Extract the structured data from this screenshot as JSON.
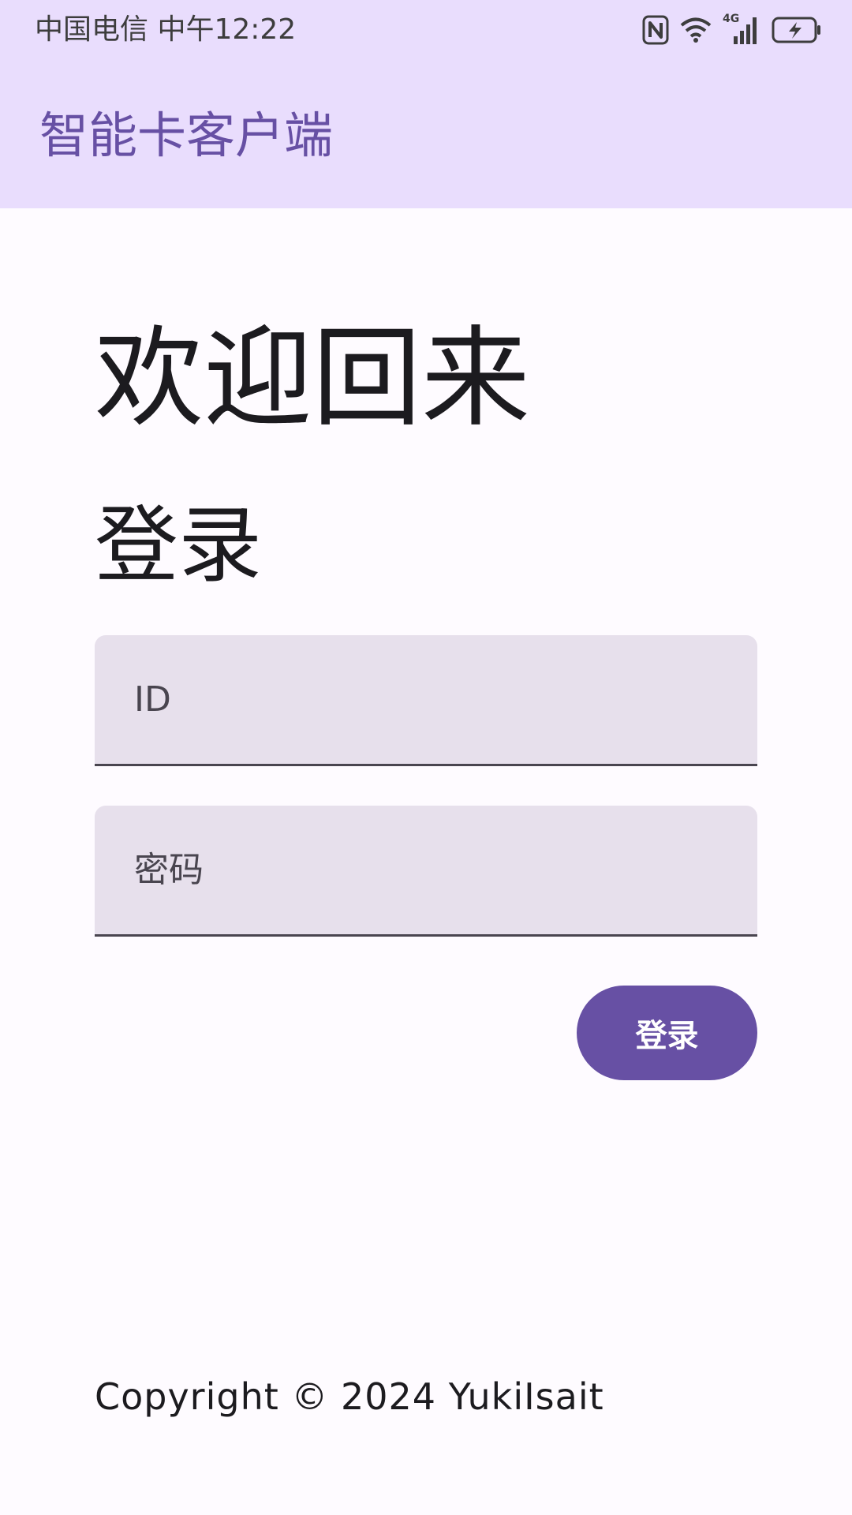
{
  "status_bar": {
    "carrier_time": "中国电信 中午12:22",
    "network_label": "4G",
    "icons": [
      "nfc-icon",
      "wifi-icon",
      "cell-signal-icon",
      "battery-charging-icon"
    ]
  },
  "app_bar": {
    "title": "智能卡客户端"
  },
  "main": {
    "welcome": "欢迎回来",
    "subtitle": "登录",
    "id_field": {
      "placeholder": "ID",
      "value": ""
    },
    "password_field": {
      "placeholder": "密码",
      "value": ""
    },
    "login_button_label": "登录"
  },
  "footer": {
    "copyright": "Copyright © 2024 YukiIsait"
  },
  "colors": {
    "header_background": "#e9ddfd",
    "primary": "#6750a4",
    "field_background": "#e7e0ec",
    "page_background": "#fefbff"
  }
}
